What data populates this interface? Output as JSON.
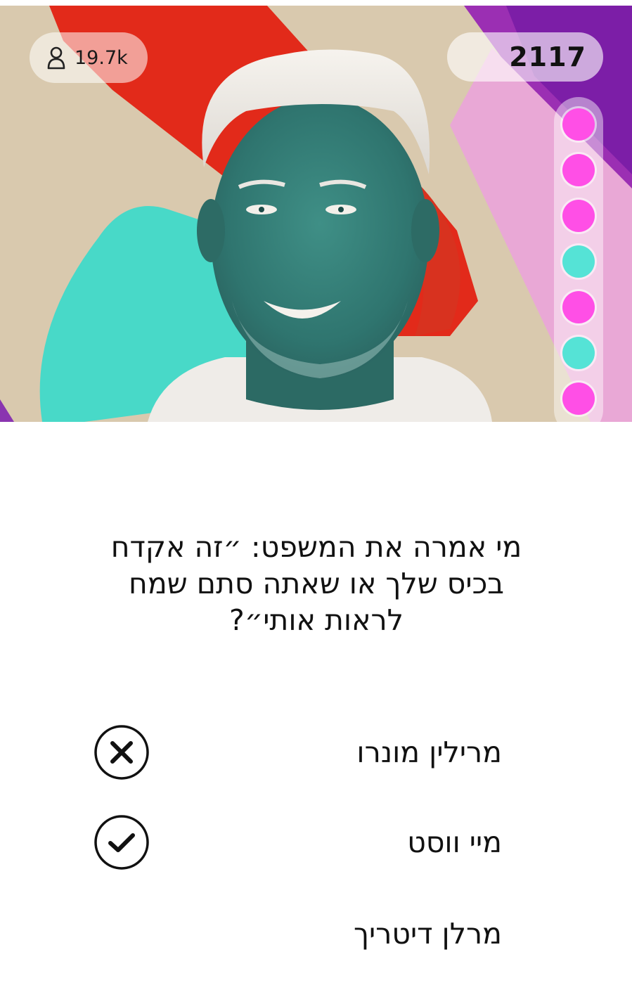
{
  "header": {
    "viewer_count": "19.7k",
    "score": "2117"
  },
  "progress": {
    "dots": [
      {
        "state": "magenta",
        "color": "#ff4fe6"
      },
      {
        "state": "magenta",
        "color": "#ff4fe6"
      },
      {
        "state": "magenta",
        "color": "#ff4fe6"
      },
      {
        "state": "cyan",
        "color": "#55e3d6"
      },
      {
        "state": "magenta",
        "color": "#ff4fe6"
      },
      {
        "state": "cyan",
        "color": "#55e3d6"
      },
      {
        "state": "magenta",
        "color": "#ff4fe6"
      }
    ]
  },
  "question": {
    "text": "מי אמרה את המשפט: ״זה אקדח בכיס שלך או שאתה סתם שמח לראות אותי״?"
  },
  "answers": [
    {
      "label": "מרילין מונרו",
      "mark": "x-circle-icon"
    },
    {
      "label": "מיי ווסט",
      "mark": "check-circle-icon"
    },
    {
      "label": "מרלן דיטריך",
      "mark": ""
    }
  ],
  "colors": {
    "magenta_dot": "#ff4fe6",
    "cyan_dot": "#55e3d6",
    "text": "#111111"
  }
}
